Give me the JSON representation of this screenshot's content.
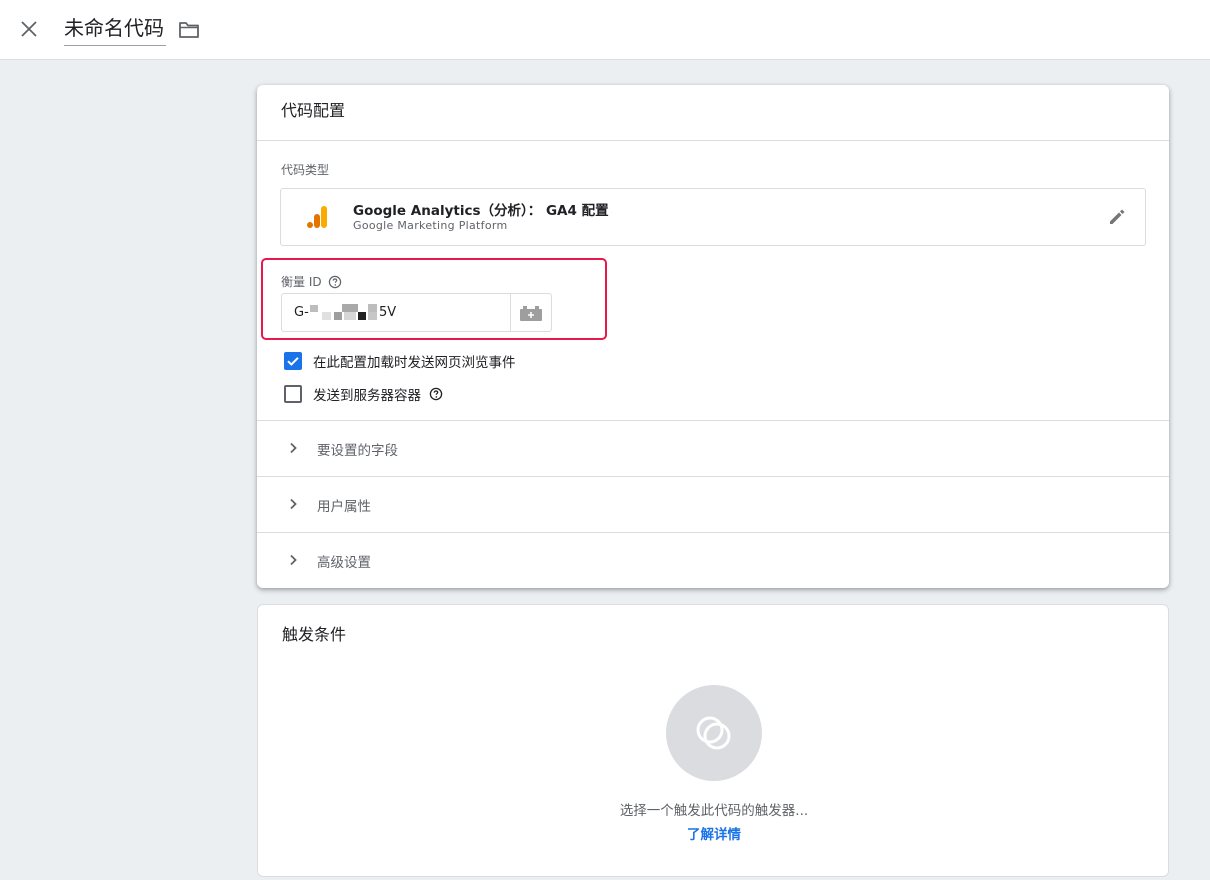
{
  "topbar": {
    "title": "未命名代码"
  },
  "tag_config": {
    "header": "代码配置",
    "tag_type_label": "代码类型",
    "tag_type_name": "Google Analytics（分析）： GA4 配置",
    "tag_type_platform": "Google Marketing Platform",
    "measurement_id_label": "衡量 ID",
    "measurement_id_prefix": "G-",
    "measurement_id_suffix": "5V",
    "checkbox_pageview_label": "在此配置加载时发送网页浏览事件",
    "checkbox_pageview_checked": true,
    "checkbox_server_label": "发送到服务器容器",
    "checkbox_server_checked": false,
    "sections": [
      {
        "label": "要设置的字段"
      },
      {
        "label": "用户属性"
      },
      {
        "label": "高级设置"
      }
    ]
  },
  "triggers": {
    "header": "触发条件",
    "hint": "选择一个触发此代码的触发器...",
    "learn_more": "了解详情"
  },
  "colors": {
    "accent": "#1a73e8",
    "highlight": "#e8184f",
    "ga_orange": "#f9ab00",
    "ga_dark_orange": "#e37400"
  },
  "icons": [
    "close-icon",
    "folder-icon",
    "ga-logo-icon",
    "edit-pencil-icon",
    "help-icon",
    "variable-icon",
    "check-icon",
    "chevron-right-icon",
    "trigger-icon"
  ]
}
